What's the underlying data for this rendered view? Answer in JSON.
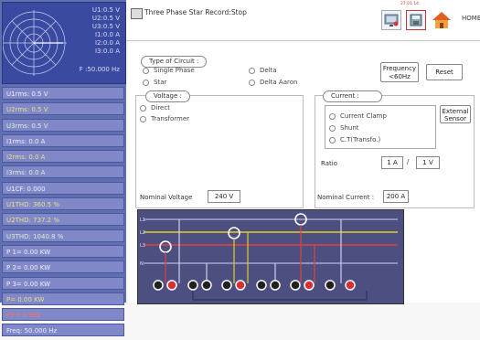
{
  "header": {
    "title": "Three Phase Star Record:Stop",
    "date_label": "27.01.14",
    "home_label": "HOME"
  },
  "scope": {
    "readouts": [
      "U1:0.5 V",
      "U2:0.5 V",
      "U3:0.5 V",
      "I1:0.0 A",
      "I2:0.0 A",
      "I3:0.0 A"
    ],
    "frequency": "F :50.000 Hz"
  },
  "measurements": [
    "U1rms: 0.5 V",
    "U2rms: 0.5 V",
    "U3rms: 0.5 V",
    "I1rms: 0.0 A",
    "I2rms: 0.0 A",
    "I3rms: 0.0 A",
    "U1CF: 0.000",
    "U1THD: 360.5 %",
    "U2THD: 737.2 %",
    "U3THD: 1040.8 %",
    "P 1= 0.00 KW",
    "P 2= 0.00 KW",
    "P 3= 0.00 KW",
    "P= 0.00 KW",
    "P.F= 0.982",
    "Freq: 50.000 Hz"
  ],
  "type_of_circuit": {
    "legend": "Type of Circuit :",
    "options": [
      "Single Phase",
      "Star",
      "Delta",
      "Delta Aaron"
    ]
  },
  "frequency_button": {
    "line1": "Frequency",
    "line2": "<60Hz"
  },
  "reset_button": "Reset",
  "voltage": {
    "legend": "Voltage :",
    "options": [
      "Direct",
      "Transformer"
    ],
    "nominal_label": "Nominal Voltage",
    "nominal_value": "240 V"
  },
  "current": {
    "legend": "Current :",
    "options": [
      "Current Clamp",
      "Shunt",
      "C.T(Transfo.)"
    ],
    "external_sensor": {
      "line1": "External",
      "line2": "Sensor"
    },
    "ratio_label": "Ratio",
    "ratio_primary": "1 A",
    "ratio_separator": "/",
    "ratio_secondary": "1 V",
    "nominal_label": "Nominal Current :",
    "nominal_value": "200 A"
  },
  "diagram": {
    "line_labels": [
      "L1",
      "L2",
      "L3",
      "N"
    ]
  },
  "colors": {
    "panel_blue": "#5f6fb0",
    "scope_blue": "#3a4aa0",
    "wire_yellow": "#e0d020",
    "wire_red": "#e04040",
    "terminal_red": "#d83030",
    "terminal_black": "#202020"
  }
}
